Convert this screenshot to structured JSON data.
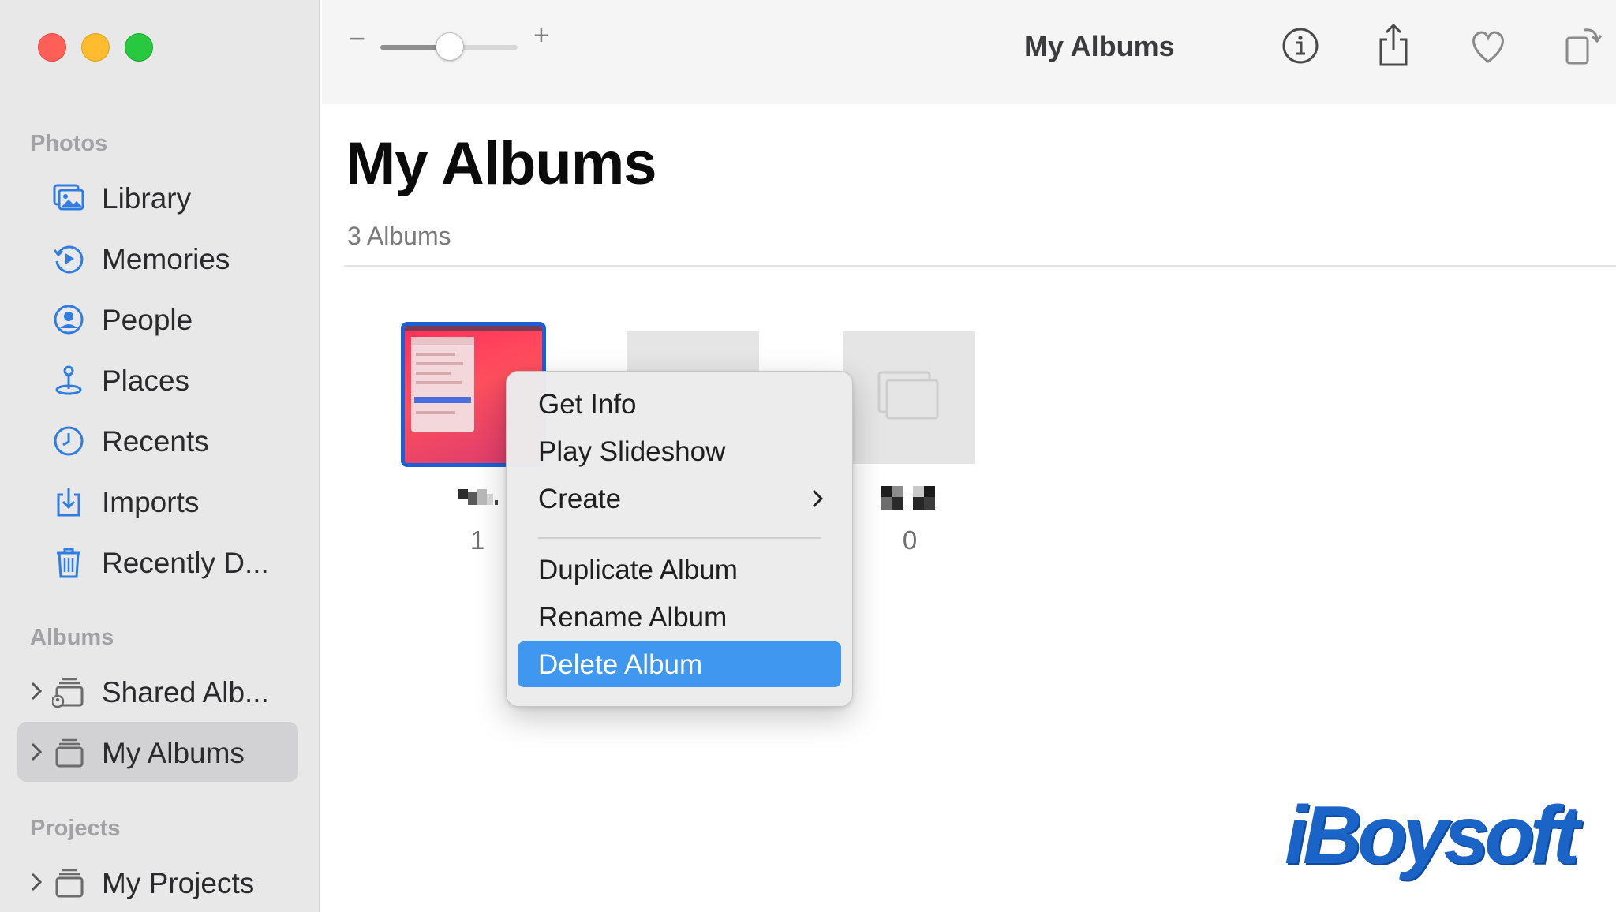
{
  "window": {
    "traffic_lights": [
      "close",
      "minimize",
      "zoom"
    ]
  },
  "sidebar": {
    "photos_label": "Photos",
    "photos_items": [
      {
        "label": "Library",
        "icon": "library-icon"
      },
      {
        "label": "Memories",
        "icon": "memories-icon"
      },
      {
        "label": "People",
        "icon": "people-icon"
      },
      {
        "label": "Places",
        "icon": "places-icon"
      },
      {
        "label": "Recents",
        "icon": "recents-icon"
      },
      {
        "label": "Imports",
        "icon": "imports-icon"
      },
      {
        "label": "Recently D...",
        "icon": "trash-icon"
      }
    ],
    "albums_label": "Albums",
    "albums_items": [
      {
        "label": "Shared Alb...",
        "icon": "shared-albums-icon",
        "selected": false
      },
      {
        "label": "My Albums",
        "icon": "albums-stack-icon",
        "selected": true
      }
    ],
    "projects_label": "Projects",
    "projects_items": [
      {
        "label": "My Projects",
        "icon": "projects-stack-icon"
      }
    ]
  },
  "toolbar": {
    "title": "My Albums",
    "zoom_minus": "−",
    "zoom_plus": "+",
    "zoom_level": 0.5,
    "icons": [
      "info-icon",
      "share-icon",
      "heart-icon",
      "rotate-icon"
    ]
  },
  "main": {
    "title": "My Albums",
    "album_count": "3 Albums",
    "albums": [
      {
        "name": "(obscured)",
        "count": "1",
        "selected": true
      },
      {
        "name": "",
        "count": "",
        "selected": false
      },
      {
        "name": "(obscured)",
        "count": "0",
        "selected": false
      }
    ]
  },
  "context_menu": {
    "items": [
      {
        "label": "Get Info"
      },
      {
        "label": "Play Slideshow"
      },
      {
        "label": "Create",
        "submenu": true
      },
      {
        "label": "Duplicate Album"
      },
      {
        "label": "Rename Album"
      },
      {
        "label": "Delete Album",
        "highlighted": true
      }
    ]
  },
  "watermark": {
    "text": "iBoysoft"
  },
  "colors": {
    "accent": "#1a5fd6",
    "menu_highlight": "#3f97f0",
    "sidebar_bg": "#e8e8e8",
    "watermark": "#1a63c7"
  }
}
